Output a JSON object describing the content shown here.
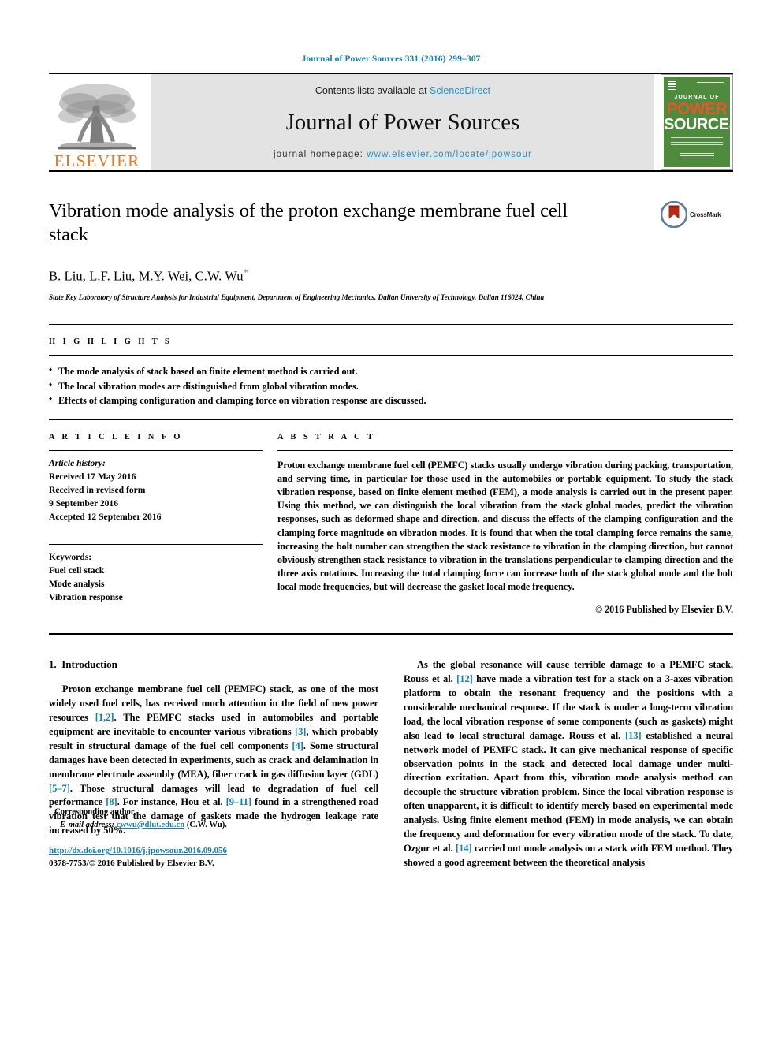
{
  "running_head": "Journal of Power Sources 331 (2016) 299–307",
  "masthead": {
    "publisher_wordmark": "ELSEVIER",
    "contents_prefix": "Contents lists available at ",
    "contents_link": "ScienceDirect",
    "journal_name": "Journal of Power Sources",
    "homepage_prefix": "journal homepage: ",
    "homepage_link": "www.elsevier.com/locate/jpowsour",
    "cover": {
      "line_journal_of": "JOURNAL OF",
      "line_power": "POWER",
      "line_sources": "SOURCES"
    },
    "colors": {
      "band_bg": "#e3e3e3",
      "link_blue": "#2d8fbf",
      "elsevier_orange": "#E87722",
      "cover_green": "#4e8b3c",
      "cover_orange": "#E2572B"
    }
  },
  "title_block": {
    "title": "Vibration mode analysis of the proton exchange membrane fuel cell stack",
    "authors": "B. Liu, L.F. Liu, M.Y. Wei, C.W. Wu",
    "corresponding_marker": "*",
    "affiliation": "State Key Laboratory of Structure Analysis for Industrial Equipment, Department of Engineering Mechanics, Dalian University of Technology, Dalian 116024, China",
    "crossmark_label": "CrossMark"
  },
  "highlights": {
    "heading": "H I G H L I G H T S",
    "items": [
      "The mode analysis of stack based on finite element method is carried out.",
      "The local vibration modes are distinguished from global vibration modes.",
      "Effects of clamping configuration and clamping force on vibration response are discussed."
    ]
  },
  "article_info": {
    "heading": "A R T I C L E   I N F O",
    "history_label": "Article history:",
    "history_lines": [
      "Received 17 May 2016",
      "Received in revised form",
      "9 September 2016",
      "Accepted 12 September 2016"
    ],
    "keywords_label": "Keywords:",
    "keywords": [
      "Fuel cell stack",
      "Mode analysis",
      "Vibration response"
    ]
  },
  "abstract": {
    "heading": "A B S T R A C T",
    "text": "Proton exchange membrane fuel cell (PEMFC) stacks usually undergo vibration during packing, transportation, and serving time, in particular for those used in the automobiles or portable equipment. To study the stack vibration response, based on finite element method (FEM), a mode analysis is carried out in the present paper. Using this method, we can distinguish the local vibration from the stack global modes, predict the vibration responses, such as deformed shape and direction, and discuss the effects of the clamping configuration and the clamping force magnitude on vibration modes. It is found that when the total clamping force remains the same, increasing the bolt number can strengthen the stack resistance to vibration in the clamping direction, but cannot obviously strengthen stack resistance to vibration in the translations perpendicular to clamping direction and the three axis rotations. Increasing the total clamping force can increase both of the stack global mode and the bolt local mode frequencies, but will decrease the gasket local mode frequency.",
    "copyright": "© 2016 Published by Elsevier B.V."
  },
  "introduction": {
    "section_number": "1.",
    "section_title": "Introduction",
    "left_paragraph_parts": {
      "p1": "Proton exchange membrane fuel cell (PEMFC) stack, as one of the most widely used fuel cells, has received much attention in the field of new power resources ",
      "r1": "[1,2]",
      "p2": ". The PEMFC stacks used in automobiles and portable equipment are inevitable to encounter various vibrations ",
      "r2": "[3]",
      "p3": ", which probably result in structural damage of the fuel cell components ",
      "r3": "[4]",
      "p4": ". Some structural damages have been detected in experiments, such as crack and delamination in membrane electrode assembly (MEA), fiber crack in gas diffusion layer (GDL) ",
      "r4": "[5–7]",
      "p5": ". Those structural damages will lead to degradation of fuel cell performance ",
      "r5": "[8]",
      "p6": ". For instance, Hou et al. ",
      "r6": "[9–11]",
      "p7": " found in a strengthened road vibration test that the damage of gaskets made the hydrogen leakage rate increased by 50%."
    },
    "right_paragraph_parts": {
      "p1": "As the global resonance will cause terrible damage to a PEMFC stack, Rouss et al. ",
      "r1": "[12]",
      "p2": " have made a vibration test for a stack on a 3-axes vibration platform to obtain the resonant frequency and the positions with a considerable mechanical response. If the stack is under a long-term vibration load, the local vibration response of some components (such as gaskets) might also lead to local structural damage. Rouss et al. ",
      "r2": "[13]",
      "p3": " established a neural network model of PEMFC stack. It can give mechanical response of specific observation points in the stack and detected local damage under multi-direction excitation. Apart from this, vibration mode analysis method can decouple the structure vibration problem. Since the local vibration response is often unapparent, it is difficult to identify merely based on experimental mode analysis. Using finite element method (FEM) in mode analysis, we can obtain the frequency and deformation for every vibration mode of the stack. To date, Ozgur et al. ",
      "r3": "[14]",
      "p4": " carried out mode analysis on a stack with FEM method. They showed a good agreement between the theoretical analysis"
    }
  },
  "footer": {
    "corresponding_star": "*",
    "corresponding_text": "Corresponding author.",
    "email_label": "E-mail address:",
    "email": "cwwu@dlut.edu.cn",
    "email_suffix": "(C.W. Wu).",
    "doi_url": "http://dx.doi.org/10.1016/j.jpowsour.2016.09.056",
    "issn_line": "0378-7753/© 2016 Published by Elsevier B.V."
  }
}
